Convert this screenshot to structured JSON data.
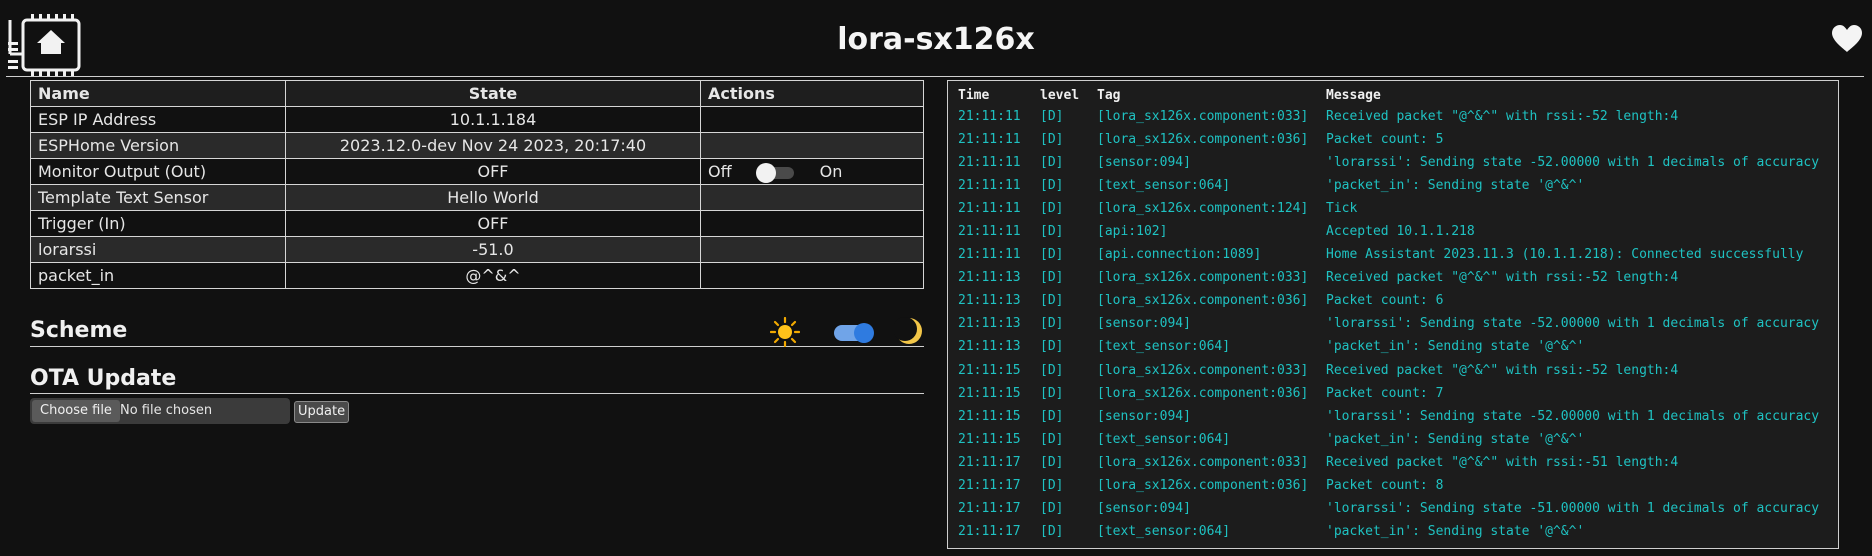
{
  "header": {
    "title": "lora-sx126x",
    "icons": {
      "logo": "esphome-home-icon",
      "heart": "heart-icon"
    }
  },
  "entities": {
    "columns": {
      "name": "Name",
      "state": "State",
      "actions": "Actions"
    },
    "rows": [
      {
        "name": "ESP IP Address",
        "state": "10.1.1.184"
      },
      {
        "name": "ESPHome Version",
        "state": "2023.12.0-dev Nov 24 2023, 20:17:40"
      },
      {
        "name": "Monitor Output (Out)",
        "state": "OFF",
        "action_off": "Off",
        "action_on": "On",
        "switch_on": false
      },
      {
        "name": "Template Text Sensor",
        "state": "Hello World"
      },
      {
        "name": "Trigger (In)",
        "state": "OFF"
      },
      {
        "name": "lorarssi",
        "state": "-51.0"
      },
      {
        "name": "packet_in",
        "state": "@^&^"
      }
    ]
  },
  "scheme": {
    "title": "Scheme",
    "dark_mode": true,
    "icons": {
      "light": "sun-icon",
      "dark": "moon-icon"
    }
  },
  "ota": {
    "title": "OTA Update",
    "choose_label": "Choose file",
    "file_status": "No file chosen",
    "update_label": "Update"
  },
  "log": {
    "columns": {
      "time": "Time",
      "level": "level",
      "tag": "Tag",
      "message": "Message"
    },
    "entries": [
      {
        "time": "21:11:11",
        "level": "[D]",
        "tag": "[lora_sx126x.component:033]",
        "message": "Received packet \"@^&^\" with rssi:-52 length:4"
      },
      {
        "time": "21:11:11",
        "level": "[D]",
        "tag": "[lora_sx126x.component:036]",
        "message": "Packet count: 5"
      },
      {
        "time": "21:11:11",
        "level": "[D]",
        "tag": "[sensor:094]",
        "message": "'lorarssi': Sending state -52.00000  with 1 decimals of accuracy"
      },
      {
        "time": "21:11:11",
        "level": "[D]",
        "tag": "[text_sensor:064]",
        "message": "'packet_in': Sending state '@^&^'"
      },
      {
        "time": "21:11:11",
        "level": "[D]",
        "tag": "[lora_sx126x.component:124]",
        "message": "Tick"
      },
      {
        "time": "21:11:11",
        "level": "[D]",
        "tag": "[api:102]",
        "message": "Accepted 10.1.1.218"
      },
      {
        "time": "21:11:11",
        "level": "[D]",
        "tag": "[api.connection:1089]",
        "message": "Home Assistant 2023.11.3 (10.1.1.218): Connected successfully"
      },
      {
        "time": "21:11:13",
        "level": "[D]",
        "tag": "[lora_sx126x.component:033]",
        "message": "Received packet \"@^&^\" with rssi:-52 length:4"
      },
      {
        "time": "21:11:13",
        "level": "[D]",
        "tag": "[lora_sx126x.component:036]",
        "message": "Packet count: 6"
      },
      {
        "time": "21:11:13",
        "level": "[D]",
        "tag": "[sensor:094]",
        "message": "'lorarssi': Sending state -52.00000  with 1 decimals of accuracy"
      },
      {
        "time": "21:11:13",
        "level": "[D]",
        "tag": "[text_sensor:064]",
        "message": "'packet_in': Sending state '@^&^'"
      },
      {
        "time": "21:11:15",
        "level": "[D]",
        "tag": "[lora_sx126x.component:033]",
        "message": "Received packet \"@^&^\" with rssi:-52 length:4"
      },
      {
        "time": "21:11:15",
        "level": "[D]",
        "tag": "[lora_sx126x.component:036]",
        "message": "Packet count: 7"
      },
      {
        "time": "21:11:15",
        "level": "[D]",
        "tag": "[sensor:094]",
        "message": "'lorarssi': Sending state -52.00000  with 1 decimals of accuracy"
      },
      {
        "time": "21:11:15",
        "level": "[D]",
        "tag": "[text_sensor:064]",
        "message": "'packet_in': Sending state '@^&^'"
      },
      {
        "time": "21:11:17",
        "level": "[D]",
        "tag": "[lora_sx126x.component:033]",
        "message": "Received packet \"@^&^\" with rssi:-51 length:4"
      },
      {
        "time": "21:11:17",
        "level": "[D]",
        "tag": "[lora_sx126x.component:036]",
        "message": "Packet count: 8"
      },
      {
        "time": "21:11:17",
        "level": "[D]",
        "tag": "[sensor:094]",
        "message": "'lorarssi': Sending state -51.00000  with 1 decimals of accuracy"
      },
      {
        "time": "21:11:17",
        "level": "[D]",
        "tag": "[text_sensor:064]",
        "message": "'packet_in': Sending state '@^&^'"
      }
    ]
  }
}
